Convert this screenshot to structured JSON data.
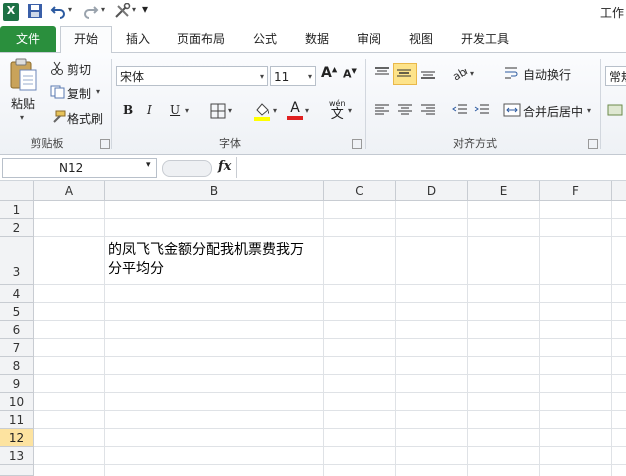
{
  "app": {
    "title_fragment": "工作"
  },
  "qat": {
    "customize_glyph": "▾"
  },
  "tabs": [
    {
      "label": "文件"
    },
    {
      "label": "开始"
    },
    {
      "label": "插入"
    },
    {
      "label": "页面布局"
    },
    {
      "label": "公式"
    },
    {
      "label": "数据"
    },
    {
      "label": "审阅"
    },
    {
      "label": "视图"
    },
    {
      "label": "开发工具"
    }
  ],
  "ribbon": {
    "clipboard": {
      "paste": "粘贴",
      "cut": "剪切",
      "copy": "复制",
      "format_painter": "格式刷",
      "group": "剪贴板"
    },
    "font": {
      "font_name": "宋体",
      "font_size": "11",
      "grow": "A",
      "shrink": "A",
      "bold": "B",
      "italic": "I",
      "underline": "U",
      "wen": "wén",
      "wen_char": "文",
      "font_color_glyph": "A",
      "group": "字体"
    },
    "alignment": {
      "wrap": "自动换行",
      "merge": "合并后居中",
      "group": "对齐方式"
    },
    "number": {
      "format": "常规"
    }
  },
  "formula_bar": {
    "name_box": "N12",
    "fx": "fx"
  },
  "sheet": {
    "columns": [
      "A",
      "B",
      "C",
      "D",
      "E",
      "F"
    ],
    "rows": [
      "1",
      "2",
      "3",
      "4",
      "5",
      "6",
      "7",
      "8",
      "9",
      "10",
      "11",
      "12",
      "13"
    ],
    "selected_row": "12",
    "cell_B3": {
      "line1": "的凤飞飞金额分配我机票费我万",
      "line2": "分平均分"
    }
  },
  "colors": {
    "file_tab": "#2a8f3d",
    "selected_row": "#fde3a0"
  }
}
